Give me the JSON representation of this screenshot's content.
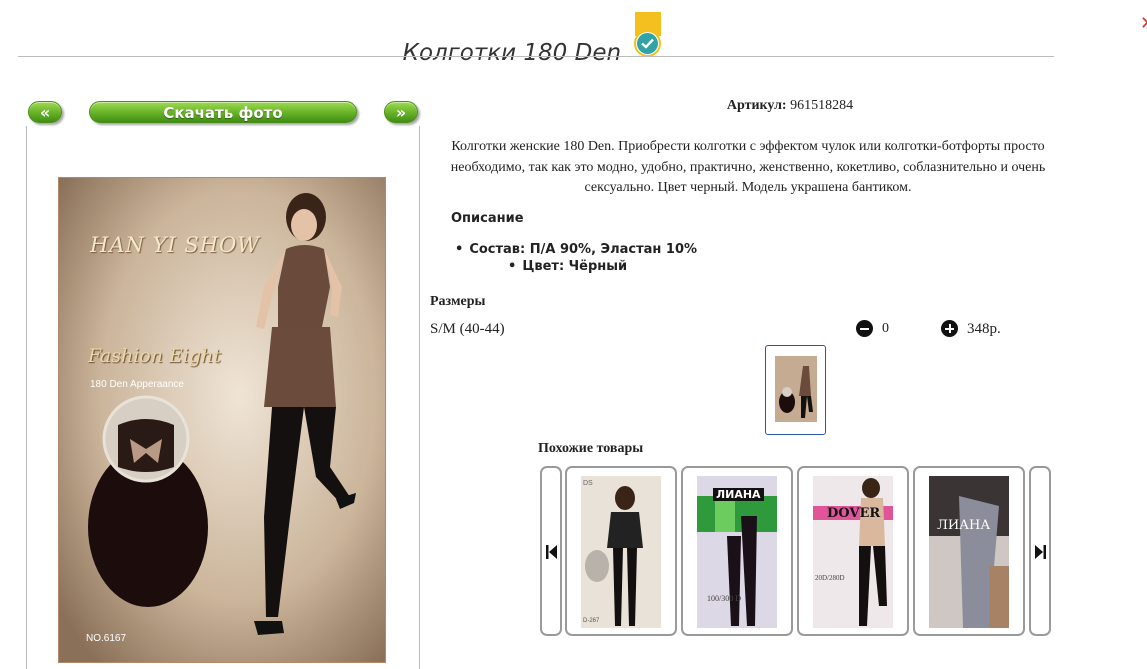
{
  "product": {
    "title": "Колготки 180 Den",
    "article_label": "Артикул:",
    "article_value": "961518284",
    "description": "Колготки женские 180 Den. Приобрести колготки с эффектом чулок или колготки-ботфорты просто необходимо, так как это модно, удобно, практично, женственно, кокетливо, соблазнительно и очень сексуально. Цвет черный. Модель украшена бантиком.",
    "description_heading": "Описание",
    "bullets": [
      "Состав: П/А 90%, Эластан 10%",
      "Цвет: Чёрный"
    ]
  },
  "gallery": {
    "prev_label": "«",
    "download_label": "Скачать фото",
    "next_label": "»",
    "package": {
      "brand": "HAN YI SHOW",
      "script": "Fashion  Eight",
      "subtitle": "180 Den Apperaance",
      "model_no": "NO.6167"
    }
  },
  "sizes": {
    "heading": "Размеры",
    "rows": [
      {
        "name": "S/M (40-44)",
        "qty": "0",
        "price": "348р."
      }
    ]
  },
  "similar": {
    "heading": "Похожие товары",
    "cards": [
      {
        "label": "DS",
        "mark": "D-267"
      },
      {
        "label": "ЛИАНА",
        "mark": "100/300 D"
      },
      {
        "label": "DOVER",
        "mark": "20D/280D"
      },
      {
        "label": "ЛИАНА",
        "mark": ""
      }
    ]
  },
  "colors": {
    "button_green": "#6cb52a",
    "accent_teal": "#2fa3a8",
    "badge_gold": "#f4c020",
    "thumb_border": "#2a58a0"
  }
}
